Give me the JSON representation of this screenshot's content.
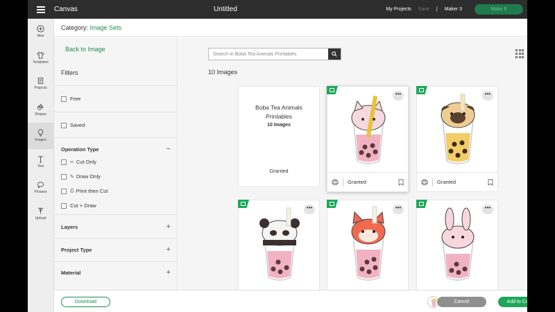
{
  "app": {
    "title": "Canvas",
    "document_title": "Untitled"
  },
  "topbar": {
    "my_projects": "My Projects",
    "save": "Save",
    "machine": "Maker 3",
    "make_it": "Make It"
  },
  "tools": [
    {
      "label": "New",
      "icon": "plus-circle-icon"
    },
    {
      "label": "Templates",
      "icon": "shirt-icon"
    },
    {
      "label": "Projects",
      "icon": "projects-icon"
    },
    {
      "label": "Shapes",
      "icon": "shapes-icon"
    },
    {
      "label": "Images",
      "icon": "lightbulb-icon"
    },
    {
      "label": "Text",
      "icon": "text-icon"
    },
    {
      "label": "Phrases",
      "icon": "speech-bubble-icon"
    },
    {
      "label": "Upload",
      "icon": "upload-icon"
    }
  ],
  "category": {
    "prefix": "Category:",
    "name": "Image Sets"
  },
  "filters": {
    "back": "Back to Image",
    "title": "Filters",
    "free": "Free",
    "saved": "Saved",
    "operation_type": "Operation Type",
    "op_items": [
      "Cut Only",
      "Draw Only",
      "Print then Cut",
      "Cut + Draw"
    ],
    "layers": "Layers",
    "project_type": "Project Type",
    "material": "Material"
  },
  "search": {
    "placeholder": "Search in Boba Tea Animals Printables"
  },
  "results": {
    "count": "10 Images"
  },
  "info_card": {
    "name": "Boba Tea Animals Printables",
    "count": "10 Images",
    "status": "Granted"
  },
  "cards": [
    {
      "animal": "cat",
      "status": "Granted",
      "cup": "#f1b3c3",
      "head": "#f6d9df"
    },
    {
      "animal": "pug",
      "status": "Granted",
      "cup": "#f3cd6a",
      "head": "#f0cc95"
    },
    {
      "animal": "panda",
      "status": "",
      "cup": "#f1b3c3",
      "head": "#f4f4f4"
    },
    {
      "animal": "fox",
      "status": "",
      "cup": "#f1b3c3",
      "head": "#f06a50"
    },
    {
      "animal": "bunny",
      "status": "",
      "cup": "#f1b3c3",
      "head": "#f7d6dc"
    }
  ],
  "bottom": {
    "download": "Download",
    "cancel": "Cancel",
    "add": "Add to Canvas"
  },
  "colors": {
    "accent": "#1fa65a",
    "topbar": "#2d2d2d"
  }
}
